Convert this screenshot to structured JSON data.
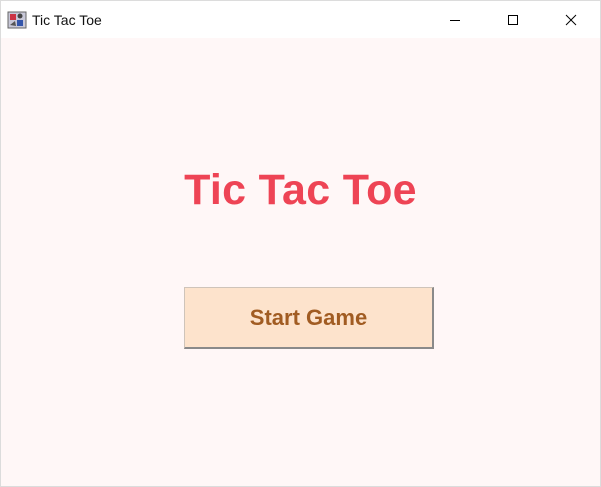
{
  "window": {
    "title": "Tic Tac Toe",
    "icon": "java-app-icon",
    "controls": {
      "minimize_icon": "minimize-icon",
      "maximize_icon": "maximize-icon",
      "close_icon": "close-icon"
    }
  },
  "main": {
    "heading": "Tic Tac Toe",
    "start_button_label": "Start Game"
  },
  "colors": {
    "background": "#fff7f7",
    "heading": "#ee4455",
    "button_bg": "#fde3cc",
    "button_text": "#a15c22"
  }
}
